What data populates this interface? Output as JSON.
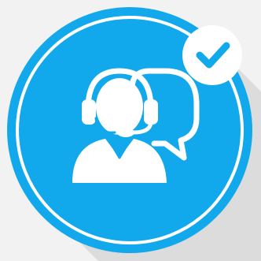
{
  "badge": {
    "icon": "customer-support-agent-icon",
    "status_icon": "checkmark-icon",
    "colors": {
      "background": "#f2f2f2",
      "shadow": "#dcdcdc",
      "circle_fill": "#11a9ec",
      "ring": "#ffffff",
      "glyph": "#ffffff",
      "check_badge_fill": "#ffffff",
      "check_mark": "#11a9ec"
    }
  }
}
